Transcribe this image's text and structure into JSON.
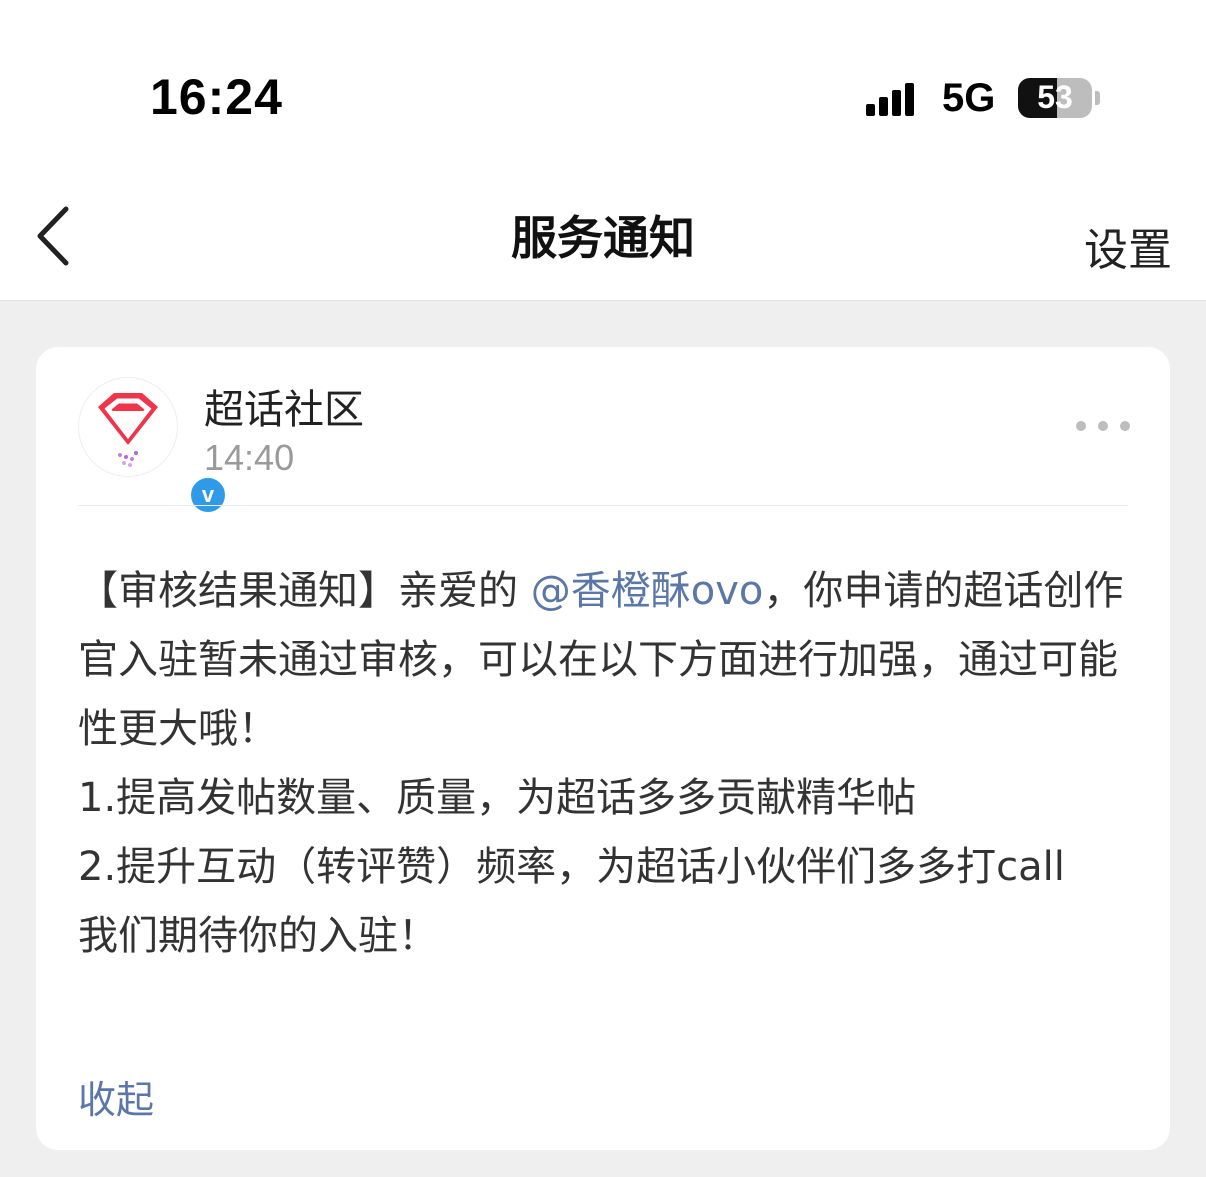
{
  "status_bar": {
    "time": "16:24",
    "network": "5G",
    "battery_level": "53",
    "battery_fraction": 0.53
  },
  "nav": {
    "back_icon": "chevron-left-icon",
    "title": "服务通知",
    "settings_label": "设置"
  },
  "message": {
    "sender": "超话社区",
    "time": "14:40",
    "avatar_icon": "super-topic-logo-icon",
    "verified_icon": "verified-v-icon",
    "verified_mark": "v",
    "more_icon": "more-dots-icon",
    "body": {
      "prefix": "【审核结果通知】亲爱的 ",
      "mention": "@香橙酥ovo",
      "after_mention": "，你申请的超话创作官入驻暂未通过审核，可以在以下方面进行加强，通过可能性更大哦！",
      "item1": "1.提高发帖数量、质量，为超话多多贡献精华帖",
      "item2": "2.提升互动（转评赞）频率，为超话小伙伴们多多打call",
      "closing": "我们期待你的入驻！"
    },
    "collapse_label": "收起"
  },
  "colors": {
    "background": "#efefef",
    "card": "#ffffff",
    "link": "#5a77a8",
    "muted": "#9a9a9a",
    "verified": "#2f9ae8",
    "logo_red": "#f0344a"
  }
}
